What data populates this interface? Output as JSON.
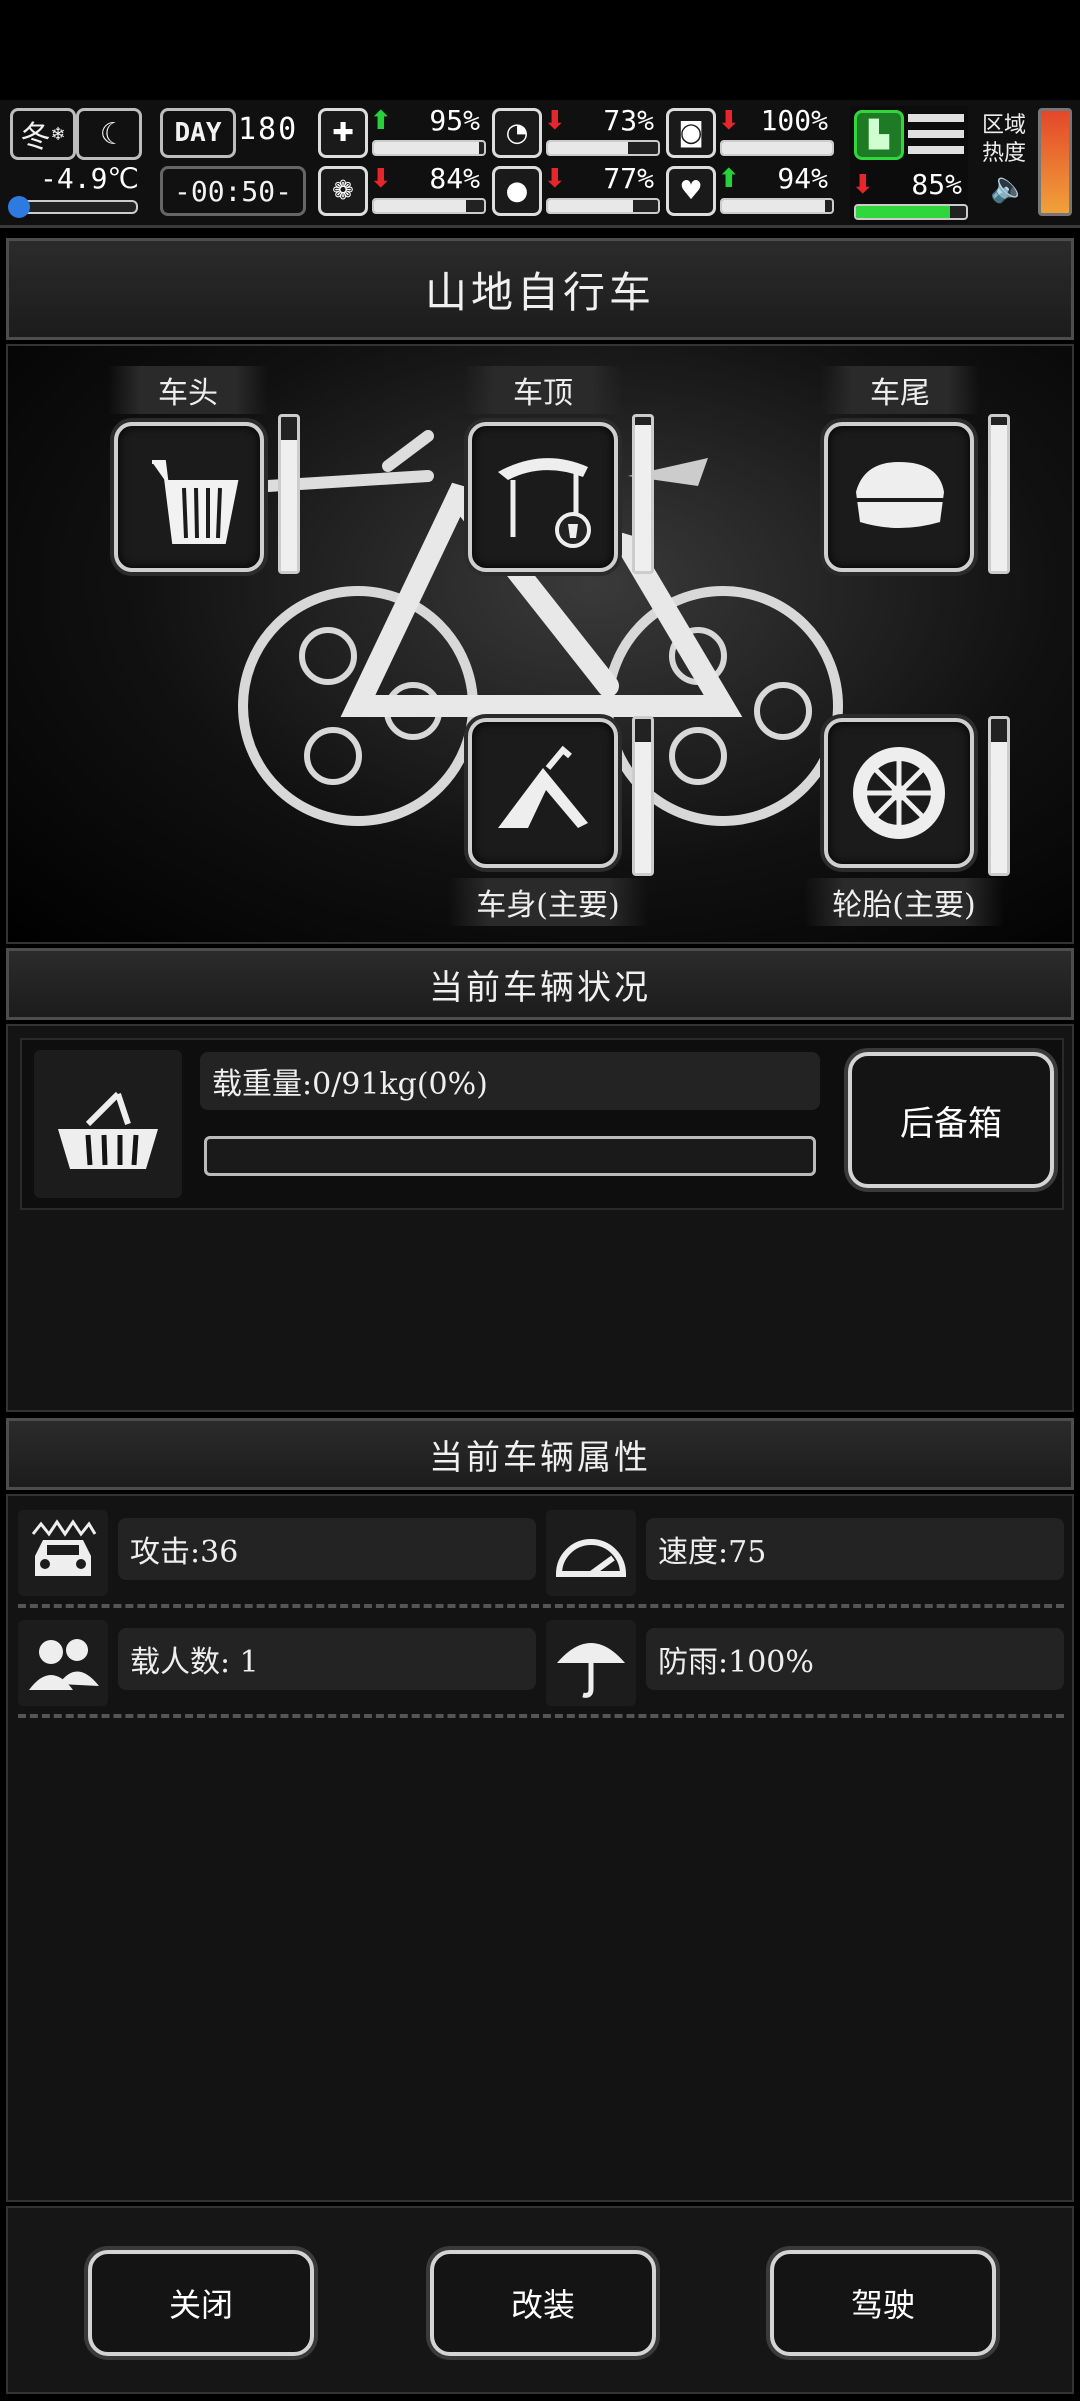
{
  "hud": {
    "season": "冬",
    "temperature": "-4.9℃",
    "day_label": "DAY",
    "day_number": "180",
    "clock": "-00:50-",
    "stats": [
      {
        "icon": "medkit-icon",
        "trend": "up",
        "value": "95%",
        "level": 0.95
      },
      {
        "icon": "stomach-icon",
        "trend": "down",
        "value": "73%",
        "level": 0.73
      },
      {
        "icon": "bladder-icon",
        "trend": "down",
        "value": "100%",
        "level": 1.0
      },
      {
        "icon": "brain-icon",
        "trend": "down",
        "value": "84%",
        "level": 0.84
      },
      {
        "icon": "water-drop-icon",
        "trend": "down",
        "value": "77%",
        "level": 0.77
      },
      {
        "icon": "heart-icon",
        "trend": "up",
        "value": "94%",
        "level": 0.94
      }
    ],
    "stamina_trend": "down",
    "stamina_value": "85%",
    "stamina_level": 0.85,
    "region_heat_label": "区域热度",
    "colors": {
      "up": "#26d13b",
      "down": "#e6262b",
      "heat_top": "#e4472a",
      "heat_bottom": "#f0a23a"
    }
  },
  "vehicle": {
    "name": "山地自行车",
    "slots": [
      {
        "label": "车头",
        "icon": "front-basket-icon",
        "durability": 0.85
      },
      {
        "label": "车顶",
        "icon": "canopy-icon",
        "durability": 0.95
      },
      {
        "label": "车尾",
        "icon": "rear-box-icon",
        "durability": 0.95
      },
      {
        "label": "车身(主要)",
        "icon": "frame-icon",
        "durability": 0.85
      },
      {
        "label": "轮胎(主要)",
        "icon": "tire-icon",
        "durability": 0.85
      }
    ]
  },
  "status": {
    "title": "当前车辆状况",
    "load_text": "载重量:0/91kg(0%)",
    "load_level": 0,
    "trunk_button": "后备箱"
  },
  "attributes": {
    "title": "当前车辆属性",
    "items": [
      {
        "icon": "car-attack-icon",
        "text": "攻击:36"
      },
      {
        "icon": "speedometer-icon",
        "text": "速度:75"
      },
      {
        "icon": "passengers-icon",
        "text": "载人数: 1"
      },
      {
        "icon": "umbrella-icon",
        "text": "防雨:100%"
      }
    ]
  },
  "footer": {
    "close": "关闭",
    "modify": "改装",
    "drive": "驾驶"
  }
}
